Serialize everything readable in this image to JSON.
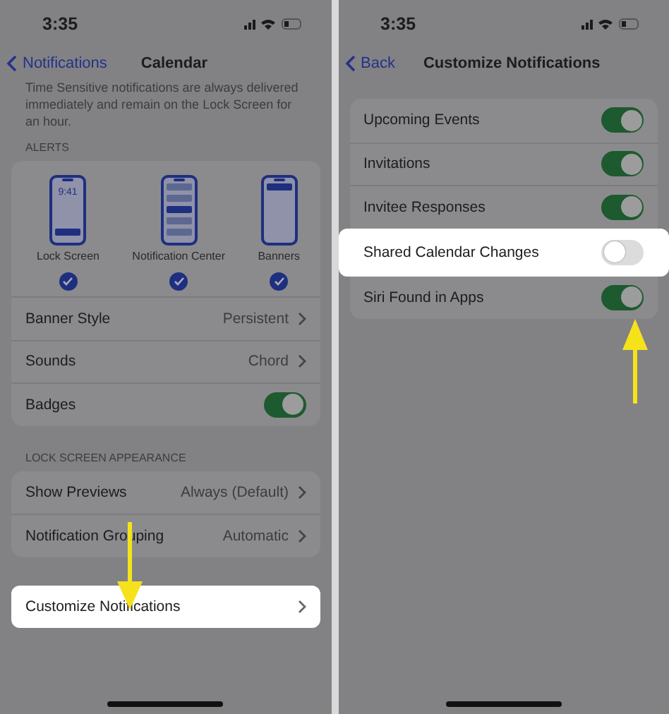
{
  "calendar_screen": {
    "status_bar": {
      "time": "3:35"
    },
    "nav": {
      "back": "Notifications",
      "title": "Calendar"
    },
    "description": "Time Sensitive notifications are always delivered immediately and remain on the Lock Screen for an hour.",
    "alerts_header": "ALERTS",
    "alerts": [
      {
        "kind": "lock",
        "label": "Lock Screen",
        "clock": "9:41",
        "checked": true
      },
      {
        "kind": "center",
        "label": "Notification Center",
        "checked": true
      },
      {
        "kind": "banner",
        "label": "Banners",
        "checked": true
      }
    ],
    "alert_rows": [
      {
        "kind": "value",
        "label": "Banner Style",
        "value": "Persistent"
      },
      {
        "kind": "value",
        "label": "Sounds",
        "value": "Chord"
      },
      {
        "kind": "toggle",
        "label": "Badges",
        "on": true
      }
    ],
    "lock_header": "LOCK SCREEN APPEARANCE",
    "lock_rows": [
      {
        "label": "Show Previews",
        "value": "Always (Default)"
      },
      {
        "label": "Notification Grouping",
        "value": "Automatic"
      }
    ],
    "customize": {
      "label": "Customize Notifications",
      "highlighted": true
    }
  },
  "customize_screen": {
    "status_bar": {
      "time": "3:35"
    },
    "nav": {
      "back": "Back",
      "title": "Customize Notifications"
    },
    "rows": [
      {
        "label": "Upcoming Events",
        "on": true,
        "highlighted": false
      },
      {
        "label": "Invitations",
        "on": true,
        "highlighted": false
      },
      {
        "label": "Invitee Responses",
        "on": true,
        "highlighted": false
      },
      {
        "label": "Shared Calendar Changes",
        "on": false,
        "highlighted": true
      },
      {
        "label": "Siri Found in Apps",
        "on": true,
        "highlighted": false
      }
    ]
  }
}
